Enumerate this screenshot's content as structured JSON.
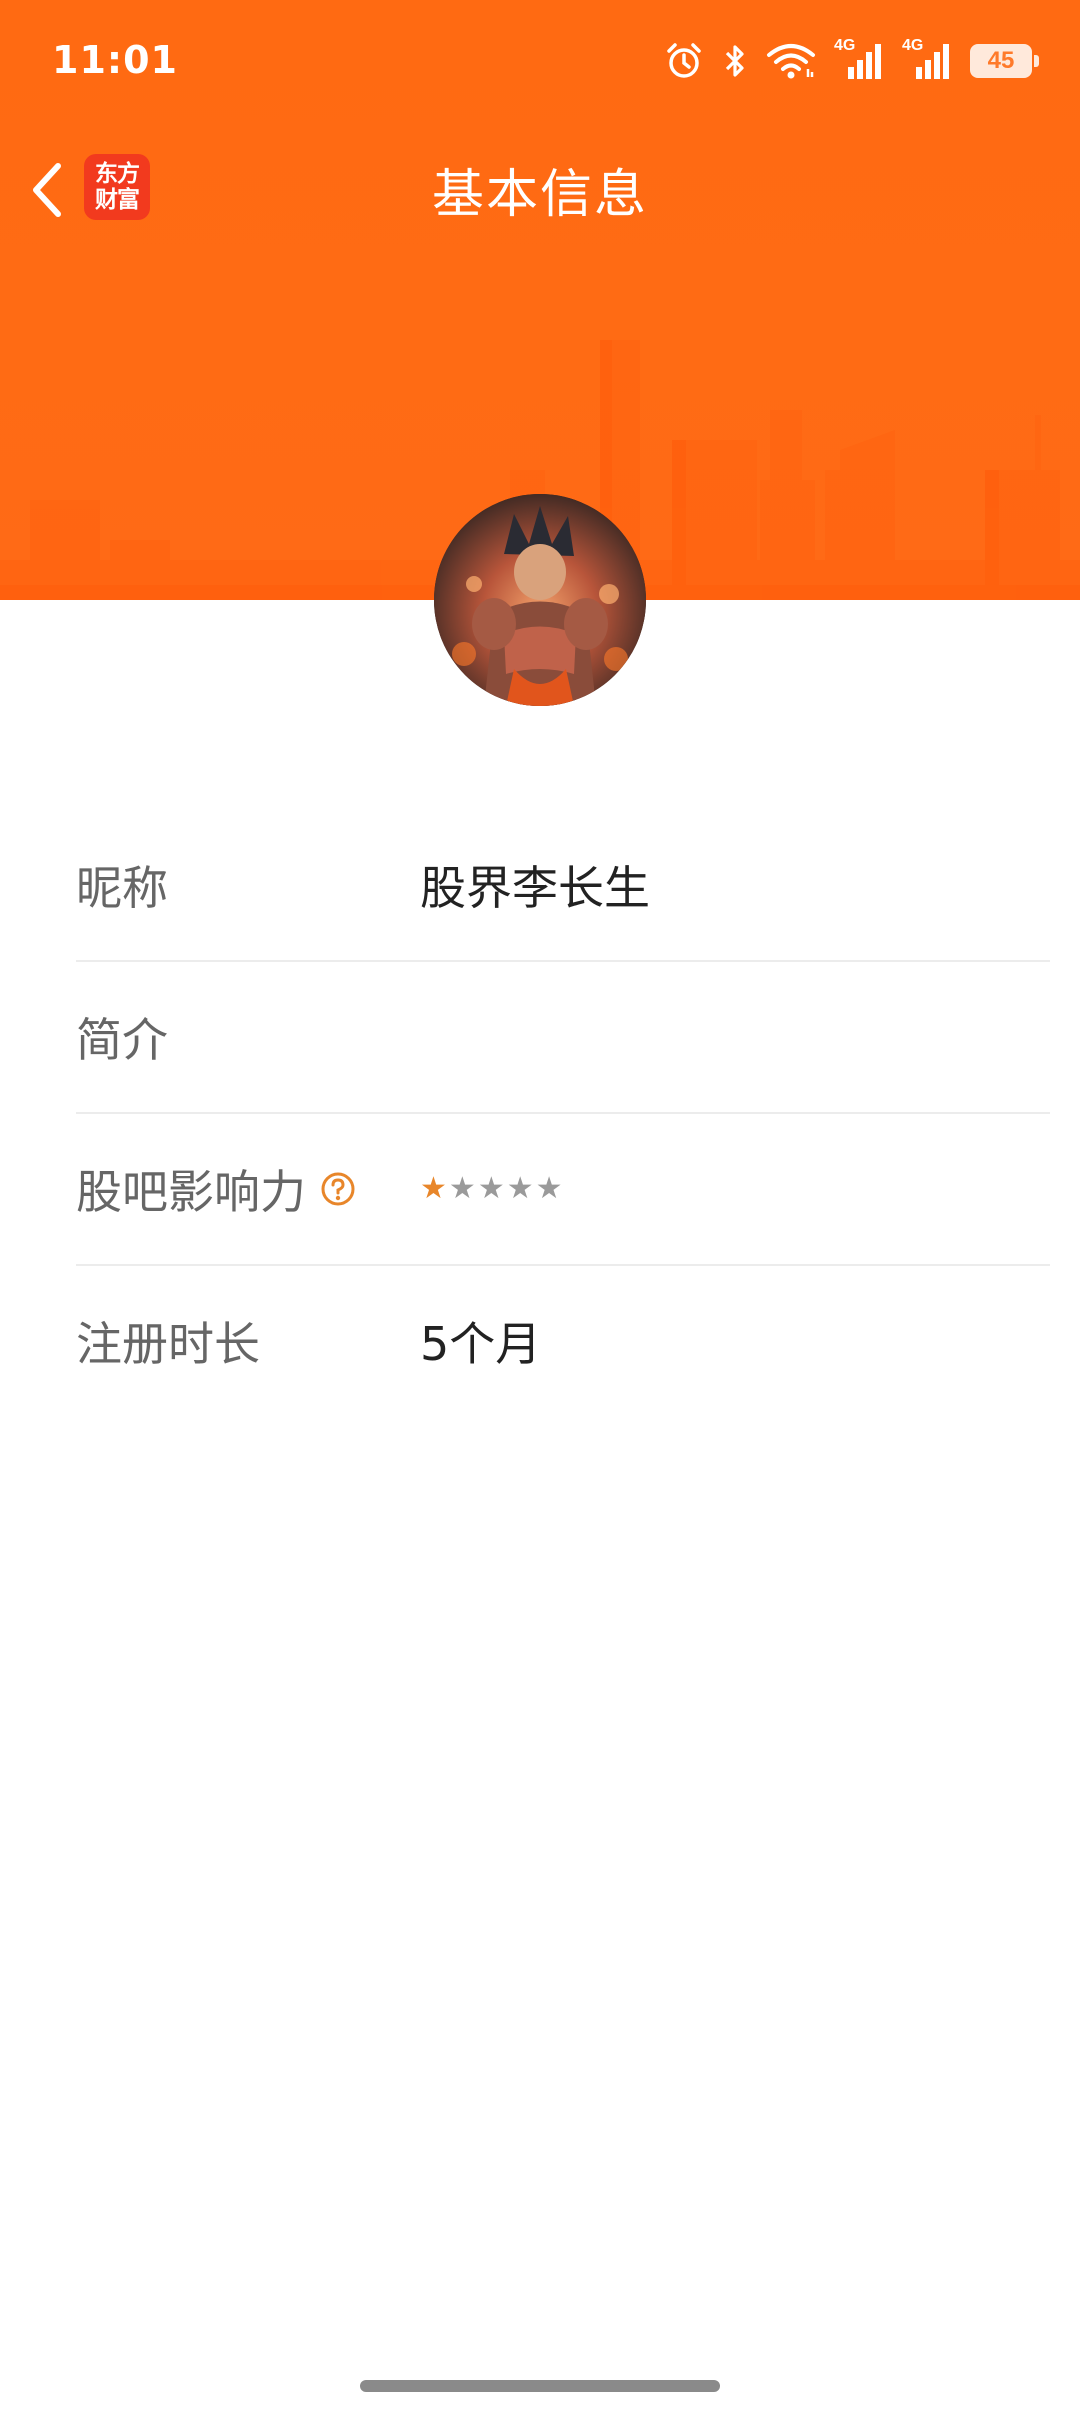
{
  "status_bar": {
    "time": "11:01",
    "battery": "45",
    "icons": [
      "alarm-icon",
      "bluetooth-icon",
      "wifi-icon",
      "signal-4g-icon",
      "signal-4g-icon",
      "battery-icon"
    ],
    "network_label_1": "4G",
    "network_label_2": "4G"
  },
  "nav": {
    "title": "基本信息",
    "back_icon": "chevron-left-icon",
    "logo_line1": "东方",
    "logo_line2": "财富"
  },
  "profile": {
    "avatar_icon": "avatar"
  },
  "info": {
    "nickname_label": "昵称",
    "nickname_value": "股界李长生",
    "bio_label": "简介",
    "bio_value": "",
    "influence_label": "股吧影响力",
    "influence_help_icon": "help-icon",
    "influence_stars": 1,
    "influence_max_stars": 5,
    "register_label": "注册时长",
    "register_value": "5个月"
  },
  "colors": {
    "brand_orange": "#ff6a12",
    "logo_red": "#f23a1e",
    "star_orange": "#e8862a",
    "star_gray": "#9a9a9a"
  }
}
